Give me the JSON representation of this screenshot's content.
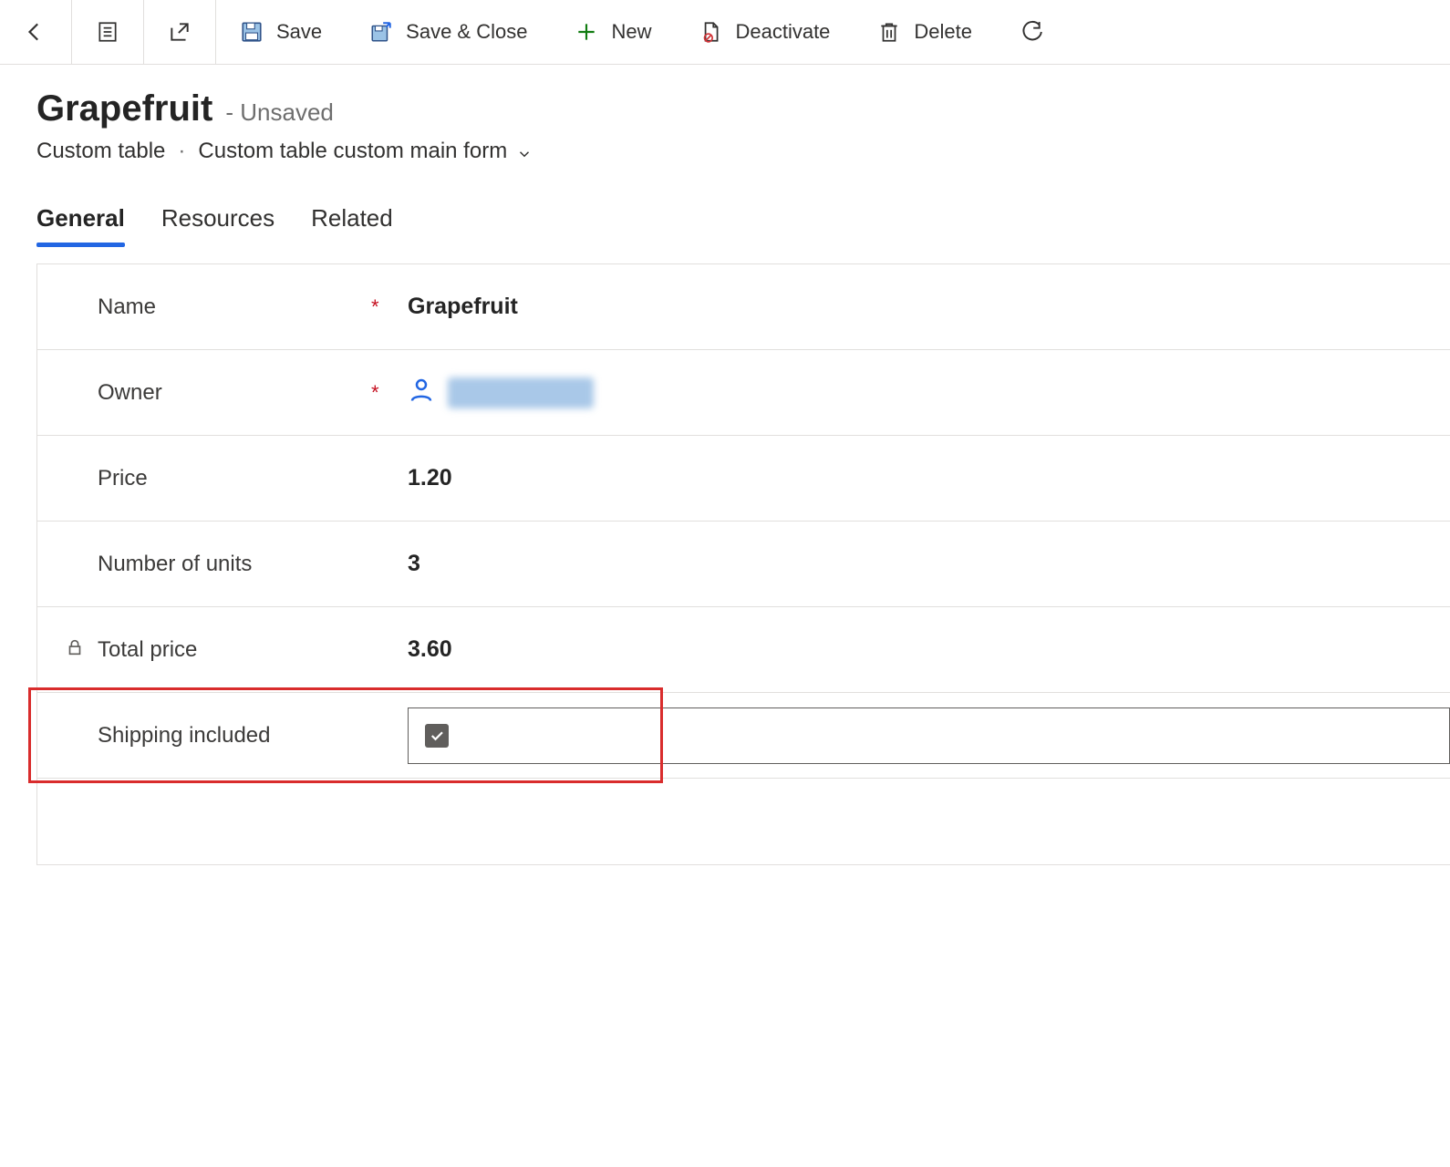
{
  "toolbar": {
    "save": "Save",
    "save_close": "Save & Close",
    "new": "New",
    "deactivate": "Deactivate",
    "delete": "Delete"
  },
  "header": {
    "title": "Grapefruit",
    "state_prefix": "- ",
    "state": "Unsaved",
    "entity": "Custom table",
    "form_name": "Custom table custom main form"
  },
  "tabs": {
    "general": "General",
    "resources": "Resources",
    "related": "Related"
  },
  "fields": {
    "name": {
      "label": "Name",
      "value": "Grapefruit",
      "required": "*"
    },
    "owner": {
      "label": "Owner",
      "required": "*"
    },
    "price": {
      "label": "Price",
      "value": "1.20"
    },
    "units": {
      "label": "Number of units",
      "value": "3"
    },
    "total": {
      "label": "Total price",
      "value": "3.60"
    },
    "shipping": {
      "label": "Shipping included",
      "checked": true
    }
  }
}
